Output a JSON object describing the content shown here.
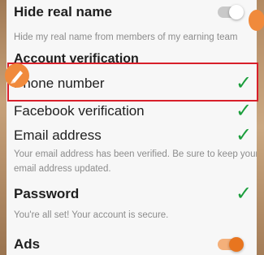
{
  "hide_real_name": {
    "title": "Hide real name",
    "description": "Hide my real name from members of my earning team",
    "toggle_on": false
  },
  "account_verification": {
    "heading": "Account verification",
    "phone": {
      "label": "Phone number",
      "verified": true
    },
    "facebook": {
      "label": "Facebook verification",
      "verified": true
    },
    "email": {
      "label": "Email address",
      "verified": true,
      "note_line1": "Your email address has been verified. Be sure to keep your",
      "note_line2": "email address updated."
    }
  },
  "password": {
    "title": "Password",
    "status": "You're all set! Your account is secure.",
    "verified": true
  },
  "ads": {
    "title": "Ads",
    "toggle_on": true
  },
  "check_glyph": "✓",
  "colors": {
    "check_green": "#1b9e3c",
    "accent_orange": "#e8751f",
    "highlight_red": "#d81f2a"
  },
  "icons": [
    "check-icon",
    "pencil-icon",
    "toggle-switch"
  ]
}
